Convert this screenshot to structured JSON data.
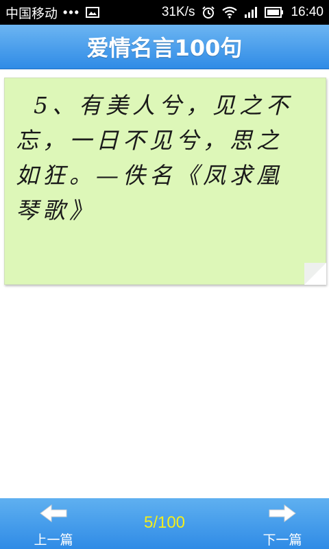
{
  "status_bar": {
    "carrier": "中国移动",
    "dots": "•••",
    "net_speed": "31K/s",
    "time": "16:40",
    "icons": [
      "image-icon",
      "alarm-icon",
      "wifi-icon",
      "signal-icon",
      "battery-icon"
    ]
  },
  "header": {
    "title": "爱情名言100句",
    "color": "#3d95ea"
  },
  "note": {
    "text": "5、有美人兮，见之不忘，一日不见兮，思之如狂。—佚名《凤求凰琴歌》",
    "background": "#ddf7b8"
  },
  "bottom_bar": {
    "prev_label": "上一篇",
    "next_label": "下一篇",
    "page_counter": "5/100",
    "counter_color": "#f5ee1a",
    "prev_icon": "arrow-left-icon",
    "next_icon": "arrow-right-icon"
  }
}
